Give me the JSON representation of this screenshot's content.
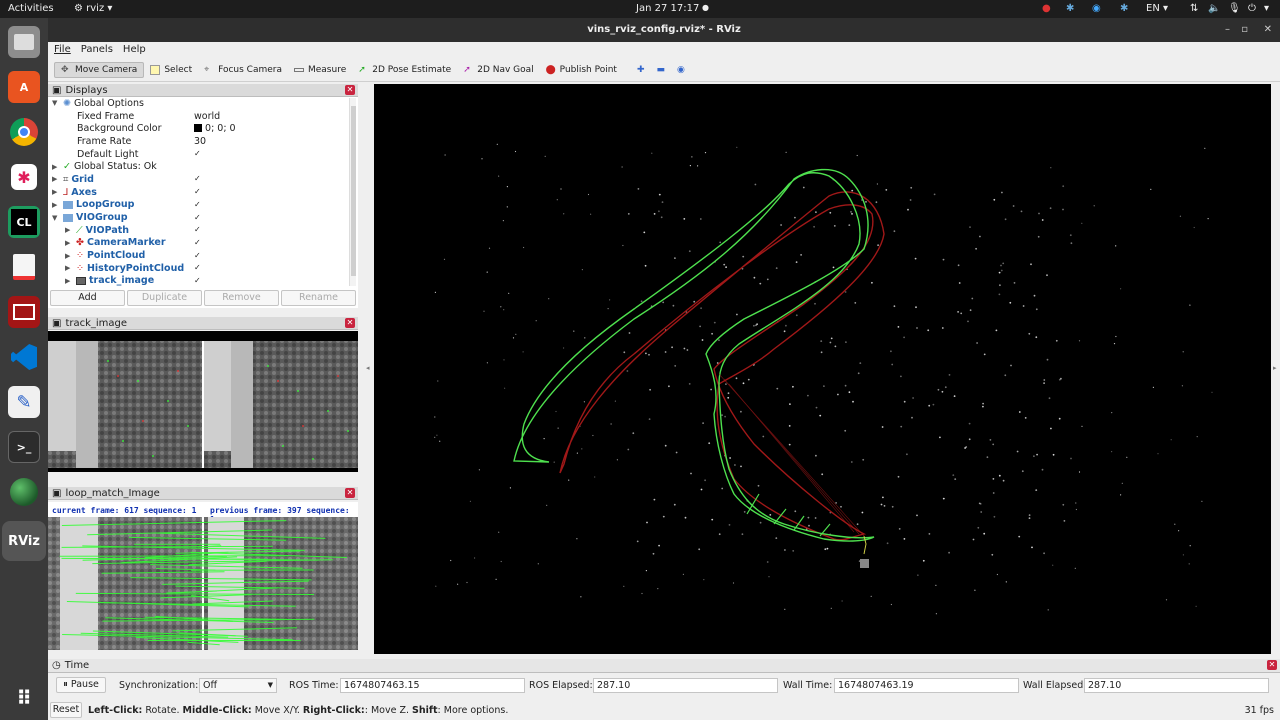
{
  "topbar": {
    "activities": "Activities",
    "app": "rviz",
    "clock": "Jan 27  17:17",
    "language": "EN"
  },
  "dock": {
    "items": [
      {
        "name": "files",
        "glyph": ""
      },
      {
        "name": "software",
        "glyph": "A"
      },
      {
        "name": "chrome",
        "glyph": ""
      },
      {
        "name": "slack",
        "glyph": ""
      },
      {
        "name": "clion",
        "glyph": "CL"
      },
      {
        "name": "document",
        "glyph": ""
      },
      {
        "name": "screen-recorder",
        "glyph": ""
      },
      {
        "name": "vscode",
        "glyph": ""
      },
      {
        "name": "text-editor",
        "glyph": ""
      },
      {
        "name": "terminal",
        "glyph": ">_"
      },
      {
        "name": "globe",
        "glyph": ""
      },
      {
        "name": "rviz",
        "glyph": "RViz"
      }
    ]
  },
  "window": {
    "title": "vins_rviz_config.rviz* - RViz"
  },
  "menu": {
    "file": "File",
    "panels": "Panels",
    "help": "Help"
  },
  "toolbar": {
    "move_camera": "Move Camera",
    "select": "Select",
    "focus_camera": "Focus Camera",
    "measure": "Measure",
    "pose_estimate": "2D Pose Estimate",
    "nav_goal": "2D Nav Goal",
    "publish_point": "Publish Point"
  },
  "displays": {
    "title": "Displays",
    "global_options": "Global Options",
    "fixed_frame_label": "Fixed Frame",
    "fixed_frame_value": "world",
    "background_label": "Background Color",
    "background_value": "0; 0; 0",
    "frame_rate_label": "Frame Rate",
    "frame_rate_value": "30",
    "default_light_label": "Default Light",
    "global_status": "Global Status: Ok",
    "grid": "Grid",
    "axes": "Axes",
    "loop_group": "LoopGroup",
    "vio_group": "VIOGroup",
    "vio_path": "VIOPath",
    "camera_marker": "CameraMarker",
    "point_cloud": "PointCloud",
    "history_point_cloud": "HistoryPointCloud",
    "track_image": "track_image",
    "buttons": {
      "add": "Add",
      "duplicate": "Duplicate",
      "remove": "Remove",
      "rename": "Rename"
    }
  },
  "track_panel": {
    "title": "track_image"
  },
  "loop_panel": {
    "title": "loop_match_Image",
    "current_frame": "current frame: 617   sequence: 1",
    "previous_frame": "previous frame: 397   sequence: 1"
  },
  "time": {
    "title": "Time",
    "pause": "Pause",
    "sync_label": "Synchronization:",
    "sync_value": "Off",
    "ros_time_label": "ROS Time:",
    "ros_time": "1674807463.15",
    "ros_elapsed_label": "ROS Elapsed:",
    "ros_elapsed": "287.10",
    "wall_time_label": "Wall Time:",
    "wall_time": "1674807463.19",
    "wall_elapsed_label": "Wall Elapsed:",
    "wall_elapsed": "287.10"
  },
  "status": {
    "reset": "Reset",
    "left_click_key": "Left-Click:",
    "left_click_text": " Rotate. ",
    "middle_click_key": "Middle-Click:",
    "middle_click_text": " Move X/Y. ",
    "right_click_key": "Right-Click:",
    "right_click_text": ": Move Z. ",
    "shift_key": "Shift",
    "shift_text": ": More options.",
    "fps": "31 fps"
  },
  "colors": {
    "vio_path": "#4ee04e",
    "loop_path": "#a01818",
    "accent_close": "#c9243f"
  }
}
